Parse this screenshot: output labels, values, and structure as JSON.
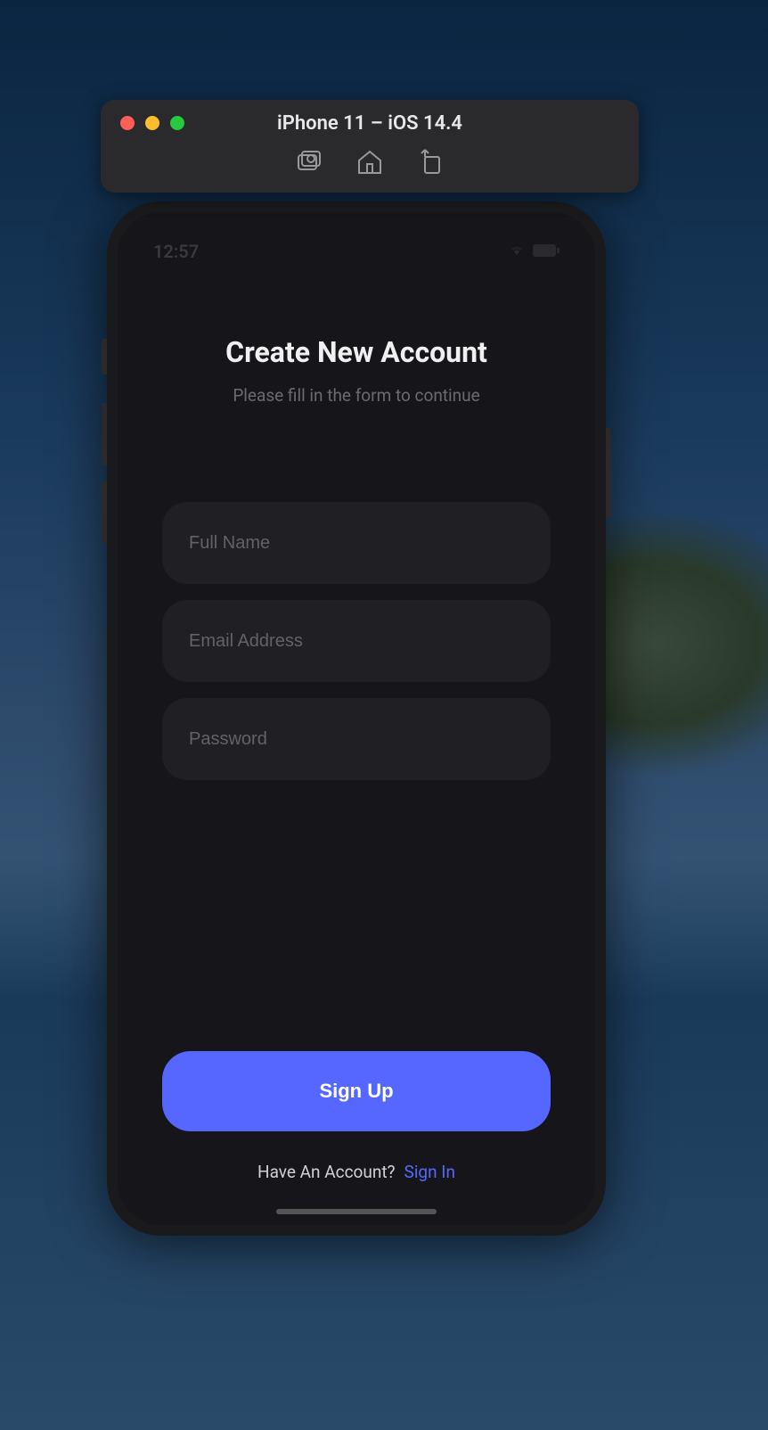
{
  "simulator": {
    "title": "iPhone 11 – iOS 14.4"
  },
  "statusBar": {
    "time": "12:57"
  },
  "app": {
    "title": "Create New Account",
    "subtitle": "Please fill in the form to continue",
    "fields": {
      "fullName": {
        "placeholder": "Full Name",
        "value": ""
      },
      "email": {
        "placeholder": "Email Address",
        "value": ""
      },
      "password": {
        "placeholder": "Password",
        "value": ""
      }
    },
    "signupButton": "Sign Up",
    "signinPrompt": "Have An Account?",
    "signinLink": "Sign In"
  },
  "colors": {
    "accent": "#5667ff",
    "inputBg": "#1f1f24",
    "screenBg": "#16161a"
  }
}
